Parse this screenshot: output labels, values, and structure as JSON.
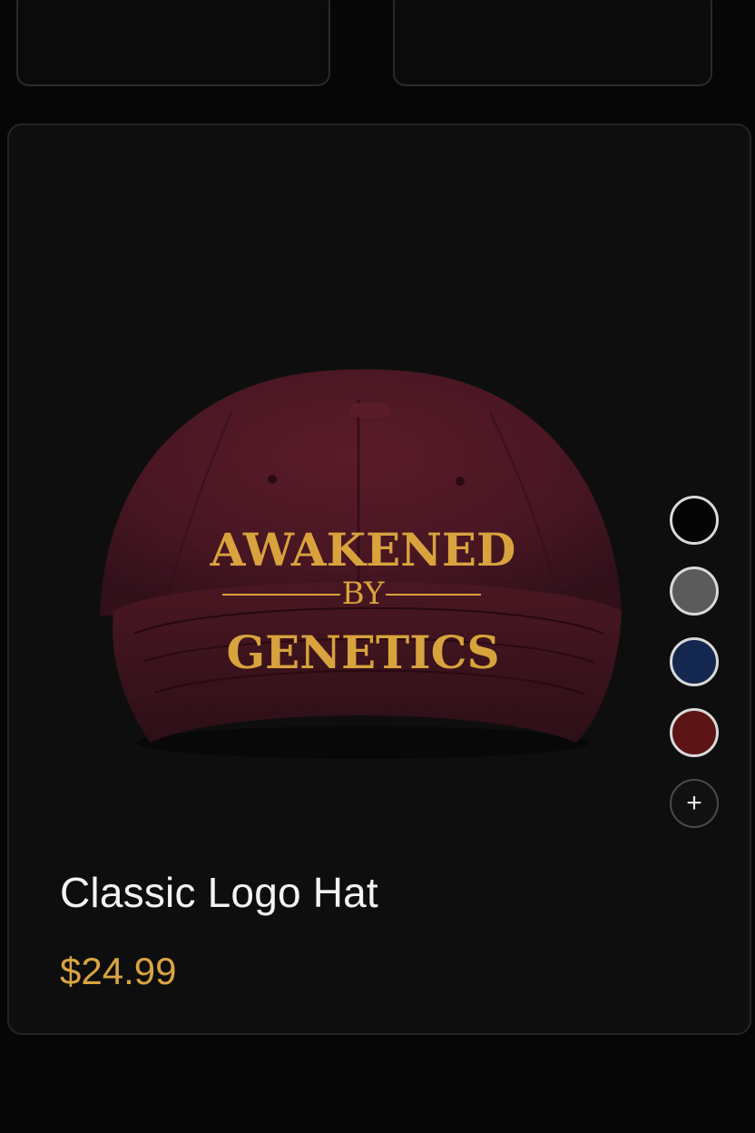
{
  "product": {
    "name": "Classic Logo Hat",
    "price": "$24.99",
    "embroidery": {
      "line1": "AWAKENED",
      "line2": "BY",
      "line3": "GENETICS"
    }
  },
  "swatches": [
    {
      "name": "black",
      "color": "#050505"
    },
    {
      "name": "gray",
      "color": "#5b5b5b"
    },
    {
      "name": "navy",
      "color": "#14274f"
    },
    {
      "name": "maroon",
      "color": "#5c1414"
    }
  ],
  "add_swatch_label": "+",
  "colors": {
    "hat": "#4a1620",
    "hat_dark": "#34101a",
    "gold": "#d8a33d",
    "background": "#0e0e0e"
  }
}
